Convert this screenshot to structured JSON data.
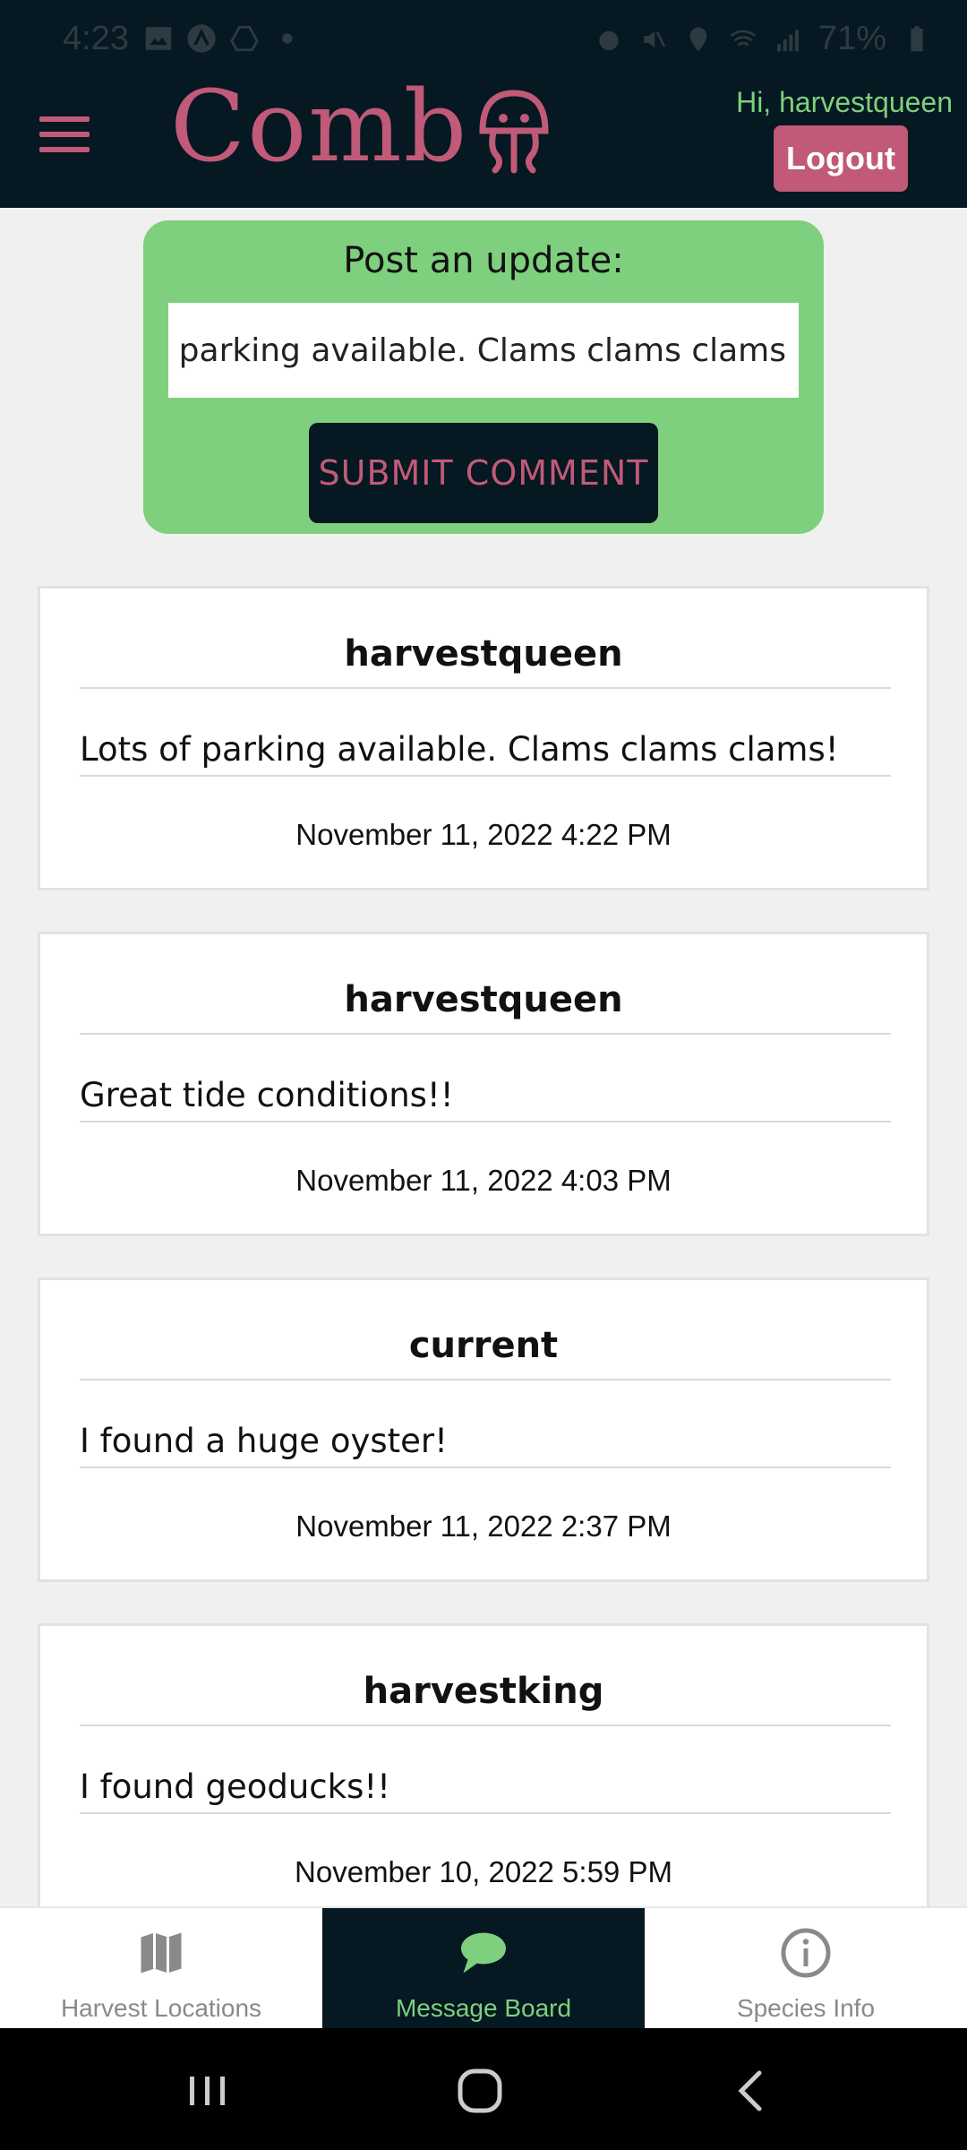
{
  "status_bar": {
    "time": "4:23",
    "battery": "71%"
  },
  "header": {
    "app_name": "Comb",
    "greeting": "Hi, harvestqueen",
    "logout_label": "Logout"
  },
  "post_update": {
    "title": "Post an update:",
    "input_value": "of parking available. Clams clams clams!",
    "submit_label": "SUBMIT COMMENT"
  },
  "comments": [
    {
      "user": "harvestqueen",
      "text": "Lots of parking available. Clams clams clams!",
      "date": "November 11, 2022 4:22 PM"
    },
    {
      "user": "harvestqueen",
      "text": "Great tide conditions!!",
      "date": "November 11, 2022 4:03 PM"
    },
    {
      "user": "current",
      "text": "I found a huge oyster!",
      "date": "November 11, 2022 2:37 PM"
    },
    {
      "user": "harvestking",
      "text": "I found geoducks!!",
      "date": "November 10, 2022 5:59 PM"
    }
  ],
  "tabs": [
    {
      "label": "Harvest Locations",
      "icon": "map-icon"
    },
    {
      "label": "Message Board",
      "icon": "chat-bubble-icon",
      "active": true
    },
    {
      "label": "Species Info",
      "icon": "info-icon"
    }
  ],
  "colors": {
    "header_bg": "#061821",
    "accent": "#c05a78",
    "green": "#7ed07e"
  }
}
